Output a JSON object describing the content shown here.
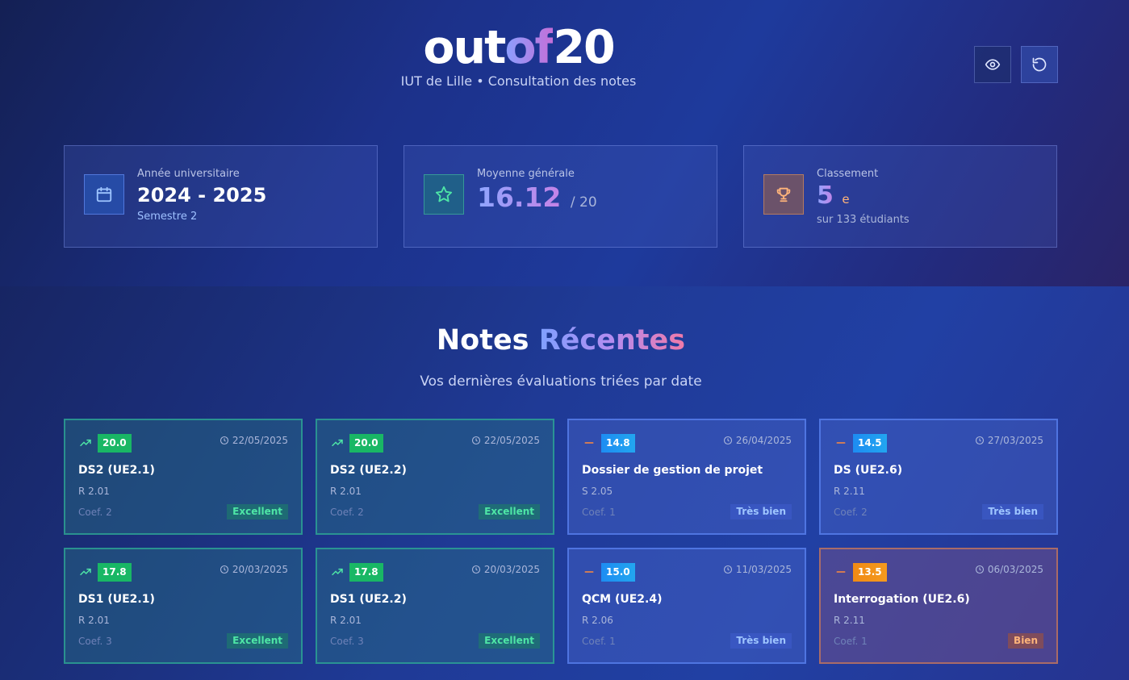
{
  "header": {
    "logo_part1": "out",
    "logo_part2": "of",
    "logo_part3": "20",
    "subtitle": "IUT de Lille • Consultation des notes",
    "eye_icon": "eye-icon",
    "reset_icon": "reset-icon"
  },
  "stats": {
    "year": {
      "label": "Année universitaire",
      "value": "2024 - 2025",
      "sub": "Semestre 2",
      "icon": "calendar-icon"
    },
    "average": {
      "label": "Moyenne générale",
      "value": "16.12",
      "suffix": "/ 20",
      "icon": "star-icon"
    },
    "rank": {
      "label": "Classement",
      "value": "5",
      "suffix": "e",
      "sub": "sur 133 étudiants",
      "icon": "trophy-icon"
    }
  },
  "section": {
    "title_part1": "Notes",
    "title_part2": "Récentes",
    "subtitle": "Vos dernières évaluations triées par date"
  },
  "cards": [
    {
      "grade": "20.0",
      "date": "22/05/2025",
      "title": "DS2 (UE2.1)",
      "code": "R 2.01",
      "coef": "Coef. 2",
      "badge": "Excellent",
      "trend_icon": "trending-up-icon"
    },
    {
      "grade": "20.0",
      "date": "22/05/2025",
      "title": "DS2 (UE2.2)",
      "code": "R 2.01",
      "coef": "Coef. 2",
      "badge": "Excellent",
      "trend_icon": "trending-up-icon"
    },
    {
      "grade": "14.8",
      "date": "26/04/2025",
      "title": "Dossier de gestion de projet",
      "code": "S 2.05",
      "coef": "Coef. 1",
      "badge": "Très bien",
      "trend_icon": "minus-icon"
    },
    {
      "grade": "14.5",
      "date": "27/03/2025",
      "title": "DS (UE2.6)",
      "code": "R 2.11",
      "coef": "Coef. 2",
      "badge": "Très bien",
      "trend_icon": "minus-icon"
    },
    {
      "grade": "17.8",
      "date": "20/03/2025",
      "title": "DS1 (UE2.1)",
      "code": "R 2.01",
      "coef": "Coef. 3",
      "badge": "Excellent",
      "trend_icon": "trending-up-icon"
    },
    {
      "grade": "17.8",
      "date": "20/03/2025",
      "title": "DS1 (UE2.2)",
      "code": "R 2.01",
      "coef": "Coef. 3",
      "badge": "Excellent",
      "trend_icon": "trending-up-icon"
    },
    {
      "grade": "15.0",
      "date": "11/03/2025",
      "title": "QCM (UE2.4)",
      "code": "R 2.06",
      "coef": "Coef. 1",
      "badge": "Très bien",
      "trend_icon": "minus-icon"
    },
    {
      "grade": "13.5",
      "date": "06/03/2025",
      "title": "Interrogation (UE2.6)",
      "code": "R 2.11",
      "coef": "Coef. 1",
      "badge": "Bien",
      "trend_icon": "minus-icon"
    }
  ],
  "colors": {
    "green": "#19b765",
    "blue": "#1d8cf2",
    "orange": "#f08a14",
    "accent_gradient_start": "#7fa0ff",
    "accent_gradient_end": "#f07aa8"
  }
}
